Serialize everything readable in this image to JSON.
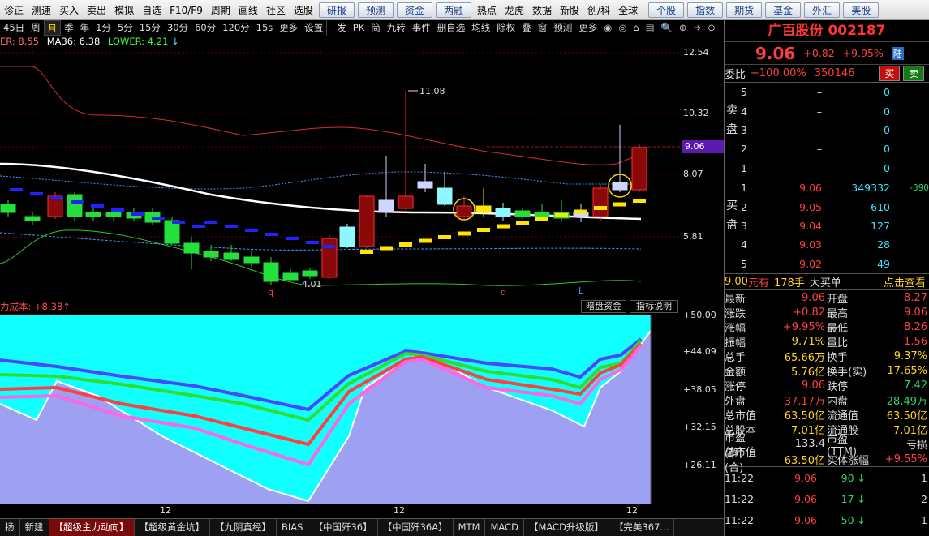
{
  "topmenu": [
    "诊正",
    "测速",
    "买入",
    "卖出",
    "模拟",
    "自选",
    "F10/F9",
    "周期",
    "画线",
    "社区",
    "选股"
  ],
  "topbuttons": [
    "研报",
    "预测",
    "资金",
    "两融"
  ],
  "topmenu2": [
    "热点",
    "龙虎",
    "数据",
    "新股",
    "创/科",
    "全球"
  ],
  "topbuttons2": [
    "个股",
    "指数",
    "期货",
    "基金",
    "外汇",
    "美股"
  ],
  "periods": [
    "45日",
    "周",
    "月",
    "季",
    "年",
    "1分",
    "5分",
    "15分",
    "30分",
    "60分",
    "120分",
    "15s",
    "更多",
    "设置"
  ],
  "active_period": "月",
  "chart_tools": [
    "发",
    "PK",
    "简",
    "九转",
    "事件",
    "删自选",
    "均线",
    "除权",
    "叠",
    "窗",
    "预测",
    "更多"
  ],
  "legend_top": {
    "upper": "ER: 8.55",
    "ma": "MA36: 6.38",
    "lower": "LOWER: 4.21"
  },
  "legend_bottom": "力成本: +8.38",
  "price_axis": [
    "12.54",
    "10.32",
    "9.06",
    "8.07",
    "5.81"
  ],
  "price_axis_current": "9.06",
  "indicator_axis": [
    "+50.00",
    "+44.09",
    "+38.05",
    "+32.15",
    "+26.11"
  ],
  "annotations": {
    "high": "11.08",
    "low": "4.01",
    "q1": "q",
    "q2": "q",
    "l": "L",
    "year_marks": [
      "12",
      "12",
      "12"
    ]
  },
  "indicator_buttons": [
    "暗盘资金",
    "指标说明"
  ],
  "bottom_tabs": [
    "扬",
    "新建",
    "【超级主力动向】",
    "【超级黄金坑】",
    "【九阴真经】",
    "BIAS",
    "【中国歼36】",
    "【中国歼36A】",
    "MTM",
    "MACD",
    "【MACD升级版】",
    "【完美367..."
  ],
  "active_tab": "【超级主力动向】",
  "stock": {
    "name": "广百股份",
    "code": "002187",
    "price": "9.06",
    "change": "+0.82",
    "pct": "+9.95%",
    "tag": "陆"
  },
  "weibi": {
    "label": "委比",
    "value": "+100.00%",
    "vol": "350146",
    "buy": "买",
    "sell": "卖"
  },
  "asks": [
    {
      "lv": "5",
      "price": "–",
      "vol": "0"
    },
    {
      "lv": "4",
      "price": "–",
      "vol": "0"
    },
    {
      "lv": "3",
      "price": "–",
      "vol": "0"
    },
    {
      "lv": "2",
      "price": "–",
      "vol": "0"
    },
    {
      "lv": "1",
      "price": "–",
      "vol": "0"
    }
  ],
  "ask_side": [
    "卖",
    "盘"
  ],
  "bids": [
    {
      "lv": "1",
      "price": "9.06",
      "vol": "349332",
      "ex": "-390"
    },
    {
      "lv": "2",
      "price": "9.05",
      "vol": "610",
      "ex": ""
    },
    {
      "lv": "3",
      "price": "9.04",
      "vol": "127",
      "ex": ""
    },
    {
      "lv": "4",
      "price": "9.03",
      "vol": "28",
      "ex": ""
    },
    {
      "lv": "5",
      "price": "9.02",
      "vol": "49",
      "ex": ""
    }
  ],
  "bid_side": [
    "买",
    "盘"
  ],
  "info_head": {
    "a": "9.00",
    "a_unit": "元有",
    "b": "178手",
    "c": "大买单",
    "d": "点击查看"
  },
  "stats": [
    {
      "k": "最新",
      "v": "9.06",
      "k2": "开盘",
      "v2": "8.27",
      "c": "red",
      "c2": "red"
    },
    {
      "k": "涨跌",
      "v": "+0.82",
      "k2": "最高",
      "v2": "9.06",
      "c": "red",
      "c2": "red"
    },
    {
      "k": "涨幅",
      "v": "+9.95%",
      "k2": "最低",
      "v2": "8.26",
      "c": "red",
      "c2": "red"
    },
    {
      "k": "振幅",
      "v": "9.71%",
      "k2": "量比",
      "v2": "1.56",
      "c": "yel",
      "c2": "red"
    },
    {
      "k": "总手",
      "v": "65.66万",
      "k2": "换手",
      "v2": "9.37%",
      "c": "yel",
      "c2": "yel"
    },
    {
      "k": "金额",
      "v": "5.76亿",
      "k2": "换手(实)",
      "v2": "17.65%",
      "c": "yel",
      "c2": "yel"
    },
    {
      "k": "涨停",
      "v": "9.06",
      "k2": "跌停",
      "v2": "7.42",
      "c": "red",
      "c2": "grn"
    },
    {
      "k": "外盘",
      "v": "37.17万",
      "k2": "内盘",
      "v2": "28.49万",
      "c": "red",
      "c2": "grn"
    },
    {
      "k": "总市值",
      "v": "63.50亿",
      "k2": "流通值",
      "v2": "63.50亿",
      "c": "yel",
      "c2": "yel"
    },
    {
      "k": "总股本",
      "v": "7.01亿",
      "k2": "流通股",
      "v2": "7.01亿",
      "c": "yel",
      "c2": "yel"
    },
    {
      "k": "市盈(静)",
      "v": "133.4",
      "k2": "市盈(TTM)",
      "v2": "亏损",
      "c": "w",
      "c2": "w"
    },
    {
      "k": "总市值(合)",
      "v": "63.50亿",
      "k2": "实体涨幅",
      "v2": "+9.55%",
      "c": "yel",
      "c2": "red"
    }
  ],
  "ticks": [
    {
      "t": "11:22",
      "p": "9.06",
      "q": "90",
      "n": "1"
    },
    {
      "t": "11:22",
      "p": "9.06",
      "q": "17",
      "n": "2"
    },
    {
      "t": "11:22",
      "p": "9.06",
      "q": "50",
      "n": "1"
    }
  ],
  "colors": {
    "up": "#ff3a3a",
    "down": "#23e03a",
    "bg": "#000000",
    "accent": "#5b1bb0"
  }
}
